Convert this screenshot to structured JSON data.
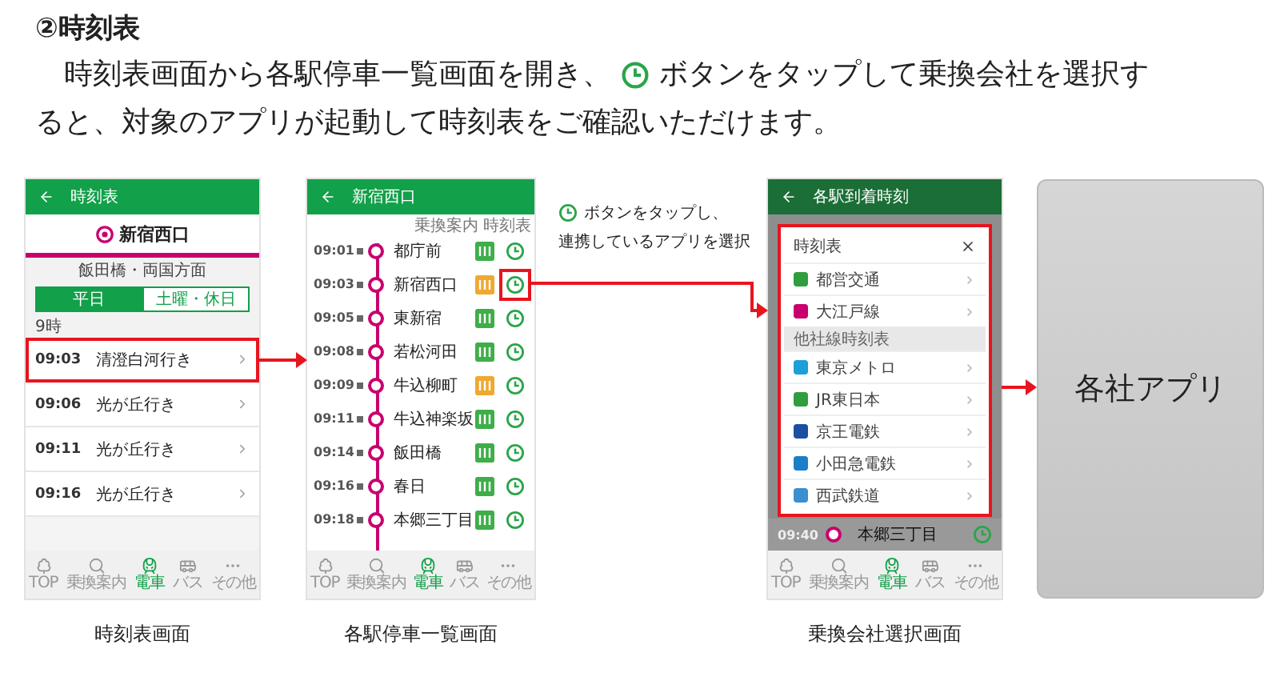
{
  "heading": "②時刻表",
  "intro": {
    "before": "　時刻表画面から各駅停車一覧画面を開き、",
    "after": "ボタンをタップして乗換会社を選択す",
    "line_2": "ると、対象のアプリが起動して時刻表をご確認いただけます。"
  },
  "timetable_screen": {
    "title": "時刻表",
    "station": "新宿西口",
    "direction": "飯田橋・両国方面",
    "tabs": [
      {
        "label": "平日",
        "selected": true
      },
      {
        "label": "土曜・休日",
        "selected": false
      }
    ],
    "hour": "9時",
    "departures": [
      {
        "time": "09:03",
        "destination": "清澄白河行き",
        "highlighted": true
      },
      {
        "time": "09:06",
        "destination": "光が丘行き",
        "highlighted": false
      },
      {
        "time": "09:11",
        "destination": "光が丘行き",
        "highlighted": false
      },
      {
        "time": "09:16",
        "destination": "光が丘行き",
        "highlighted": false
      }
    ],
    "nav": [
      {
        "kind": "top",
        "label": "TOP",
        "selected": false
      },
      {
        "kind": "search",
        "label": "乗換案内",
        "selected": false
      },
      {
        "kind": "train",
        "label": "電車",
        "selected": true
      },
      {
        "kind": "bus",
        "label": "バス",
        "selected": false
      },
      {
        "kind": "more",
        "label": "その他",
        "selected": false
      }
    ],
    "caption": "時刻表画面"
  },
  "stops_screen": {
    "title": "新宿西口",
    "columns": [
      "乗換案内",
      "時刻表"
    ],
    "stops": [
      {
        "time": "09:01",
        "station": "都庁前",
        "color": "#3fae49",
        "highlighted": false
      },
      {
        "time": "09:03",
        "station": "新宿西口",
        "color": "#f0a830",
        "highlighted": true
      },
      {
        "time": "09:05",
        "station": "東新宿",
        "color": "#3fae49",
        "highlighted": false
      },
      {
        "time": "09:08",
        "station": "若松河田",
        "color": "#3fae49",
        "highlighted": false
      },
      {
        "time": "09:09",
        "station": "牛込柳町",
        "color": "#f0a830",
        "highlighted": false
      },
      {
        "time": "09:11",
        "station": "牛込神楽坂",
        "color": "#3fae49",
        "highlighted": false
      },
      {
        "time": "09:14",
        "station": "飯田橋",
        "color": "#3fae49",
        "highlighted": false
      },
      {
        "time": "09:16",
        "station": "春日",
        "color": "#3fae49",
        "highlighted": false
      },
      {
        "time": "09:18",
        "station": "本郷三丁目",
        "color": "#3fae49",
        "highlighted": false
      }
    ],
    "nav": [
      {
        "kind": "top",
        "label": "TOP",
        "selected": false
      },
      {
        "kind": "search",
        "label": "乗換案内",
        "selected": false
      },
      {
        "kind": "train",
        "label": "電車",
        "selected": true
      },
      {
        "kind": "bus",
        "label": "バス",
        "selected": false
      },
      {
        "kind": "more",
        "label": "その他",
        "selected": false
      }
    ],
    "caption": "各駅停車一覧画面"
  },
  "callout": {
    "lines": [
      "ボタンをタップし、",
      "連携しているアプリを選択"
    ]
  },
  "company_screen": {
    "title": "各駅到着時刻",
    "dialog": {
      "title": "時刻表",
      "highlighted": true,
      "items": [
        {
          "kind": "company",
          "name": "都営交通",
          "color": "#2e9e3e"
        },
        {
          "kind": "company",
          "name": "大江戸線",
          "color": "#c8006e"
        },
        {
          "kind": "section",
          "name": "他社線時刻表"
        },
        {
          "kind": "company",
          "name": "東京メトロ",
          "color": "#1ba0d8"
        },
        {
          "kind": "company",
          "name": "JR東日本",
          "color": "#2e9e3e"
        },
        {
          "kind": "company",
          "name": "京王電鉄",
          "color": "#1c4fa0"
        },
        {
          "kind": "company",
          "name": "小田急電鉄",
          "color": "#1a7fc8"
        },
        {
          "kind": "company",
          "name": "西武鉄道",
          "color": "#3a8fd0"
        }
      ]
    },
    "last_stop": {
      "time": "09:40",
      "station": "本郷三丁目"
    },
    "nav": [
      {
        "kind": "top",
        "label": "TOP",
        "selected": false
      },
      {
        "kind": "search",
        "label": "乗換案内",
        "selected": false
      },
      {
        "kind": "train",
        "label": "電車",
        "selected": true
      },
      {
        "kind": "bus",
        "label": "バス",
        "selected": false
      },
      {
        "kind": "more",
        "label": "その他",
        "selected": false
      }
    ],
    "caption": "乗換会社選択画面"
  },
  "app_placeholder": {
    "label": "各社アプリ"
  }
}
